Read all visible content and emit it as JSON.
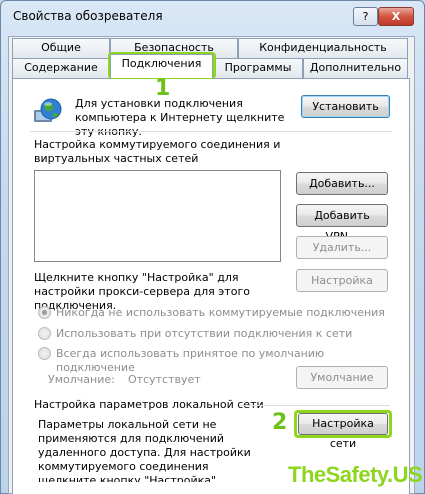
{
  "window": {
    "title": "Свойства обозревателя",
    "help_label": "?",
    "close_label": "X"
  },
  "tabs": {
    "row_back": [
      "Общие",
      "Безопасность",
      "Конфиденциальность"
    ],
    "row_front": [
      "Содержание",
      "Подключения",
      "Программы",
      "Дополнительно"
    ],
    "active": "Подключения"
  },
  "setup": {
    "text": "Для установки подключения компьютера к Интернету щелкните эту кнопку.",
    "button": "Установить",
    "icon": "globe-network-icon"
  },
  "dialup": {
    "heading": "Настройка коммутируемого соединения и виртуальных частных сетей",
    "buttons": {
      "add": "Добавить...",
      "add_vpn": "Добавить VPN...",
      "remove": "Удалить...",
      "settings": "Настройка"
    },
    "proxy_text": "Щелкните кнопку \"Настройка\" для настройки прокси-сервера для этого подключения.",
    "options": [
      "Никогда не использовать коммутируемые подключения",
      "Использовать при отсутствии подключения к сети",
      "Всегда использовать принятое по умолчанию подключение"
    ],
    "default_label": "Умолчание:",
    "default_value": "Отсутствует",
    "default_button": "Умолчание"
  },
  "lan": {
    "heading": "Настройка параметров локальной сети",
    "text": "Параметры локальной сети не применяются для подключений удаленного доступа. Для настройки коммутируемого соединения щелкните кнопку \"Настройка\", расположенную выше.",
    "button": "Настройка сети"
  },
  "markers": [
    "1",
    "2"
  ],
  "watermark": {
    "main": "TheSafety",
    "suffix": ".US"
  },
  "colors": {
    "highlight": "#8cd61d",
    "marker": "#6cc11b"
  }
}
